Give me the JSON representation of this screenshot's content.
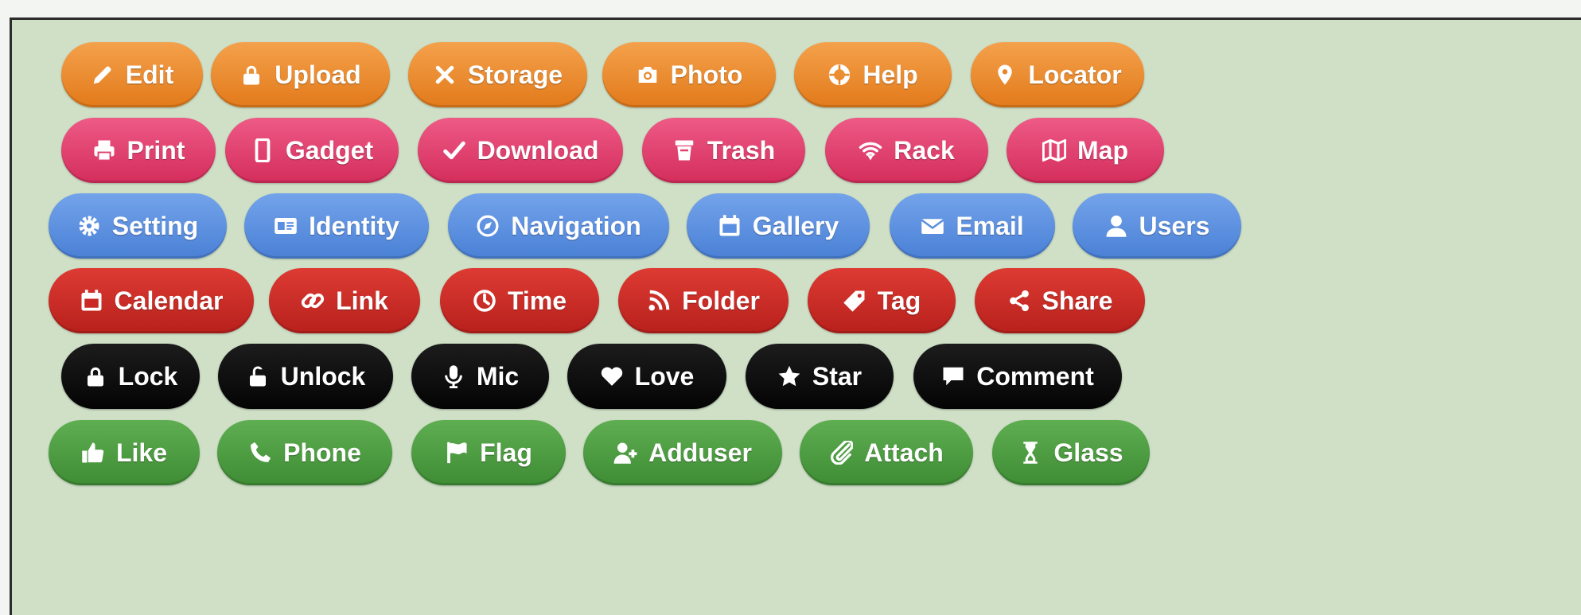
{
  "colors": {
    "orange": "#e8872a",
    "pink": "#e0406e",
    "blue": "#5a8ee0",
    "red": "#c92a25",
    "black": "#0a0a0a",
    "green": "#4c9c42",
    "panel_background": "#cfe0c7"
  },
  "rows": [
    {
      "color": "orange",
      "buttons": [
        {
          "label": "Edit",
          "icon": "pencil-icon"
        },
        {
          "label": "Upload",
          "icon": "lock-icon"
        },
        {
          "label": "Storage",
          "icon": "close-icon"
        },
        {
          "label": "Photo",
          "icon": "camera-icon"
        },
        {
          "label": "Help",
          "icon": "lifebuoy-icon"
        },
        {
          "label": "Locator",
          "icon": "map-pin-icon"
        }
      ]
    },
    {
      "color": "pink",
      "buttons": [
        {
          "label": "Print",
          "icon": "printer-icon"
        },
        {
          "label": "Gadget",
          "icon": "mobile-icon"
        },
        {
          "label": "Download",
          "icon": "checkmark-icon"
        },
        {
          "label": "Trash",
          "icon": "trash-icon"
        },
        {
          "label": "Rack",
          "icon": "wifi-icon"
        },
        {
          "label": "Map",
          "icon": "map-icon"
        }
      ]
    },
    {
      "color": "blue",
      "buttons": [
        {
          "label": "Setting",
          "icon": "gear-icon"
        },
        {
          "label": "Identity",
          "icon": "id-card-icon"
        },
        {
          "label": "Navigation",
          "icon": "compass-icon"
        },
        {
          "label": "Gallery",
          "icon": "calendar-icon"
        },
        {
          "label": "Email",
          "icon": "envelope-icon"
        },
        {
          "label": "Users",
          "icon": "user-icon"
        }
      ]
    },
    {
      "color": "red",
      "buttons": [
        {
          "label": "Calendar",
          "icon": "calendar-icon"
        },
        {
          "label": "Link",
          "icon": "link-icon"
        },
        {
          "label": "Time",
          "icon": "clock-icon"
        },
        {
          "label": "Folder",
          "icon": "rss-icon"
        },
        {
          "label": "Tag",
          "icon": "tag-icon"
        },
        {
          "label": "Share",
          "icon": "share-icon"
        }
      ]
    },
    {
      "color": "black",
      "buttons": [
        {
          "label": "Lock",
          "icon": "lock-icon"
        },
        {
          "label": "Unlock",
          "icon": "unlock-icon"
        },
        {
          "label": "Mic",
          "icon": "microphone-icon"
        },
        {
          "label": "Love",
          "icon": "heart-icon"
        },
        {
          "label": "Star",
          "icon": "star-icon"
        },
        {
          "label": "Comment",
          "icon": "comment-icon"
        }
      ]
    },
    {
      "color": "green",
      "buttons": [
        {
          "label": "Like",
          "icon": "thumbs-up-icon"
        },
        {
          "label": "Phone",
          "icon": "phone-icon"
        },
        {
          "label": "Flag",
          "icon": "flag-icon"
        },
        {
          "label": "Adduser",
          "icon": "add-user-icon"
        },
        {
          "label": "Attach",
          "icon": "attach-icon"
        },
        {
          "label": "Glass",
          "icon": "hourglass-icon"
        }
      ]
    }
  ]
}
